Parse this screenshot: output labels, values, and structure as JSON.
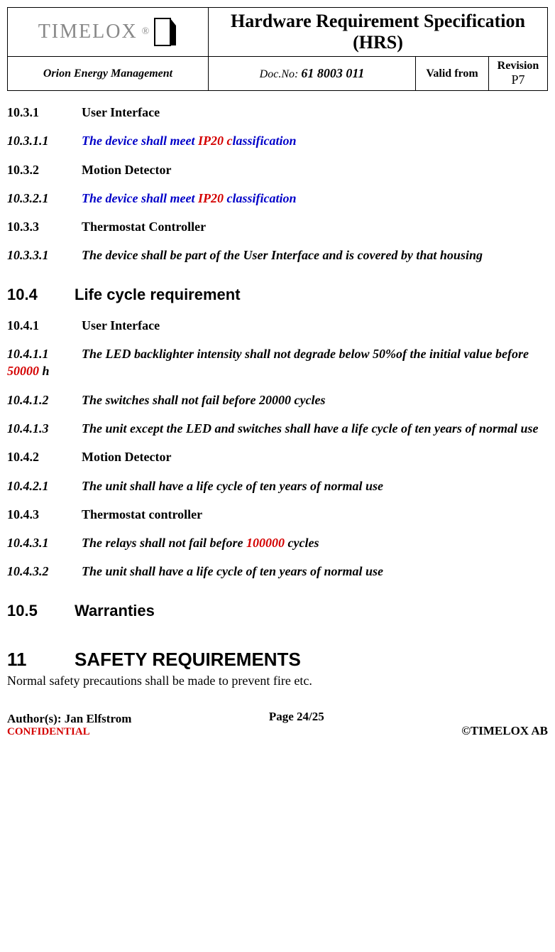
{
  "header": {
    "logo_text": "TIMELOX",
    "title": "Hardware Requirement Specification (HRS)",
    "project": "Orion Energy Management",
    "docno_label": "Doc.No:",
    "docno": "61 8003 011",
    "valid_from_label": "Valid from",
    "valid_from": "",
    "revision_label": "Revision",
    "revision": "P7"
  },
  "sections": {
    "s10_3_1": {
      "num": "10.3.1",
      "title": "User Interface"
    },
    "s10_3_1_1": {
      "num": "10.3.1.1",
      "pre": "The device shall meet ",
      "red": "IP20 c",
      "post": "lassification"
    },
    "s10_3_2": {
      "num": "10.3.2",
      "title": "Motion Detector"
    },
    "s10_3_2_1": {
      "num": "10.3.2.1",
      "pre": "The device shall meet ",
      "red": "IP20",
      "post": " classification"
    },
    "s10_3_3": {
      "num": "10.3.3",
      "title": "Thermostat Controller"
    },
    "s10_3_3_1": {
      "num": "10.3.3.1",
      "text": "The device shall be part of the User Interface and is covered by that housing"
    },
    "s10_4": {
      "num": "10.4",
      "title": "Life cycle requirement"
    },
    "s10_4_1": {
      "num": "10.4.1",
      "title": "User Interface"
    },
    "s10_4_1_1": {
      "num": "10.4.1.1",
      "pre": "The LED backlighter intensity shall not degrade below 50%of the initial value before ",
      "red": "50000",
      "post": " h"
    },
    "s10_4_1_2": {
      "num": "10.4.1.2",
      "text": "The switches shall not fail before 20000 cycles"
    },
    "s10_4_1_3": {
      "num": "10.4.1.3",
      "text": "The unit except the LED and switches shall have a life cycle of ten years of normal use"
    },
    "s10_4_2": {
      "num": "10.4.2",
      "title": "Motion Detector"
    },
    "s10_4_2_1": {
      "num": "10.4.2.1",
      "text": "The unit shall have a life cycle of ten years of normal use"
    },
    "s10_4_3": {
      "num": "10.4.3",
      "title": "Thermostat controller"
    },
    "s10_4_3_1": {
      "num": "10.4.3.1",
      "pre": "The relays shall not fail before ",
      "red": "100000",
      "post": " cycles"
    },
    "s10_4_3_2": {
      "num": "10.4.3.2",
      "text": "The unit shall have a life cycle of ten years of normal use"
    },
    "s10_5": {
      "num": "10.5",
      "title": "Warranties"
    },
    "s11": {
      "num": "11",
      "title": "SAFETY REQUIREMENTS"
    },
    "s11_body": "Normal safety precautions shall be made to prevent fire etc."
  },
  "footer": {
    "author_label": "Author(s): ",
    "author": "Jan Elfstrom",
    "page": "Page 24/25",
    "confidential": "CONFIDENTIAL",
    "copyright": "©TIMELOX AB"
  }
}
